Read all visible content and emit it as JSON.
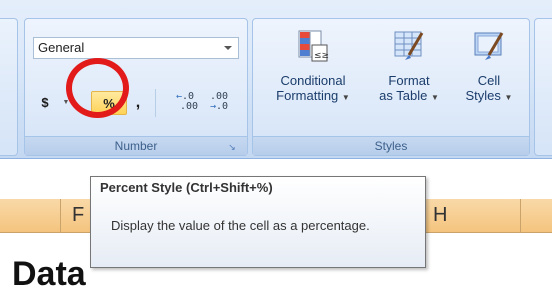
{
  "ribbon": {
    "number_group": {
      "format_value": "General",
      "currency_label": "$",
      "percent_label": "%",
      "comma_label": ",",
      "increase_decimal": [
        ".0",
        ".00"
      ],
      "decrease_decimal": [
        ".00",
        ".0"
      ],
      "group_label": "Number"
    },
    "styles_group": {
      "conditional_formatting": [
        "Conditional",
        "Formatting"
      ],
      "format_as_table": [
        "Format",
        "as Table"
      ],
      "cell_styles": [
        "Cell",
        "Styles"
      ],
      "group_label": "Styles"
    }
  },
  "tooltip": {
    "title": "Percent Style (Ctrl+Shift+%)",
    "body": "Display the value of the cell as a percentage."
  },
  "sheet": {
    "columns": [
      "F",
      "H"
    ],
    "cell_text": "Data"
  },
  "colors": {
    "highlight_ring": "#e21a1a",
    "percent_button": "#ffd257",
    "column_header": "#f4c47e"
  }
}
